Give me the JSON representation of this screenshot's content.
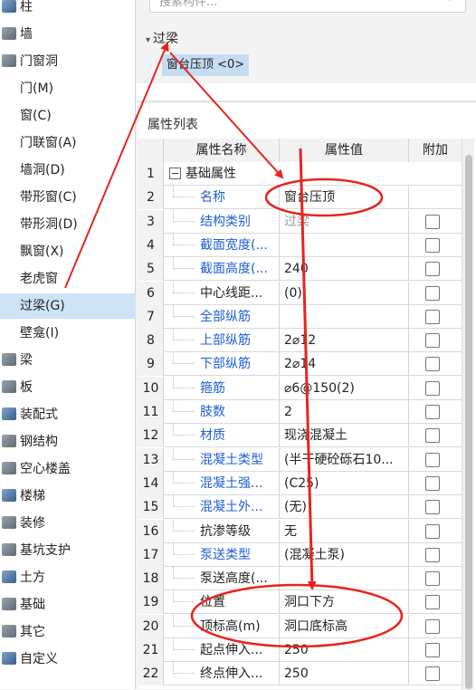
{
  "tree": [
    {
      "label": "柱",
      "kind": "cat",
      "icon": "column-icon"
    },
    {
      "label": "墙",
      "kind": "cat",
      "icon": "wall-icon"
    },
    {
      "label": "门窗洞",
      "kind": "cat",
      "icon": "door-window-icon"
    },
    {
      "label": "门(M)",
      "kind": "sub"
    },
    {
      "label": "窗(C)",
      "kind": "sub"
    },
    {
      "label": "门联窗(A)",
      "kind": "sub"
    },
    {
      "label": "墙洞(D)",
      "kind": "sub"
    },
    {
      "label": "带形窗(C)",
      "kind": "sub"
    },
    {
      "label": "带形洞(D)",
      "kind": "sub"
    },
    {
      "label": "飘窗(X)",
      "kind": "sub"
    },
    {
      "label": "老虎窗",
      "kind": "sub"
    },
    {
      "label": "过梁(G)",
      "kind": "sub",
      "selected": true
    },
    {
      "label": "壁龛(I)",
      "kind": "sub"
    },
    {
      "label": "梁",
      "kind": "cat",
      "icon": "beam-icon"
    },
    {
      "label": "板",
      "kind": "cat",
      "icon": "slab-icon"
    },
    {
      "label": "装配式",
      "kind": "cat",
      "icon": "prefab-icon"
    },
    {
      "label": "钢结构",
      "kind": "cat",
      "icon": "steel-icon"
    },
    {
      "label": "空心楼盖",
      "kind": "cat",
      "icon": "hollow-floor-icon"
    },
    {
      "label": "楼梯",
      "kind": "cat",
      "icon": "stair-icon"
    },
    {
      "label": "装修",
      "kind": "cat",
      "icon": "decoration-icon"
    },
    {
      "label": "基坑支护",
      "kind": "cat",
      "icon": "pit-support-icon"
    },
    {
      "label": "土方",
      "kind": "cat",
      "icon": "earthwork-icon"
    },
    {
      "label": "基础",
      "kind": "cat",
      "icon": "foundation-icon"
    },
    {
      "label": "其它",
      "kind": "cat",
      "icon": "other-icon"
    },
    {
      "label": "自定义",
      "kind": "cat",
      "icon": "custom-icon"
    }
  ],
  "search": {
    "placeholder": "搜索构件..."
  },
  "group": {
    "label": "过梁"
  },
  "component": {
    "label": "窗台压顶 <0>"
  },
  "props": {
    "title": "属性列表",
    "headers": [
      "属性名称",
      "属性值",
      "附加"
    ],
    "rows": [
      {
        "num": "1",
        "name": "基础属性",
        "value": "",
        "group": true
      },
      {
        "num": "2",
        "name": "名称",
        "value": "窗台压顶",
        "blue": true,
        "cb": false
      },
      {
        "num": "3",
        "name": "结构类别",
        "value": "过梁",
        "blue": true,
        "cb": true,
        "muted": true
      },
      {
        "num": "4",
        "name": "截面宽度(...",
        "value": "",
        "blue": true,
        "cb": true
      },
      {
        "num": "5",
        "name": "截面高度(...",
        "value": "240",
        "blue": true,
        "cb": true
      },
      {
        "num": "6",
        "name": "中心线距...",
        "value": "(0)",
        "cb": true
      },
      {
        "num": "7",
        "name": "全部纵筋",
        "value": "",
        "blue": true,
        "cb": true
      },
      {
        "num": "8",
        "name": "上部纵筋",
        "value": "2⌀12",
        "blue": true,
        "cb": true
      },
      {
        "num": "9",
        "name": "下部纵筋",
        "value": "2⌀14",
        "blue": true,
        "cb": true
      },
      {
        "num": "10",
        "name": "箍筋",
        "value": "⌀6@150(2)",
        "blue": true,
        "cb": true
      },
      {
        "num": "11",
        "name": "肢数",
        "value": "2",
        "blue": true,
        "cb": true
      },
      {
        "num": "12",
        "name": "材质",
        "value": "现浇混凝土",
        "blue": true,
        "cb": true
      },
      {
        "num": "13",
        "name": "混凝土类型",
        "value": "(半干硬砼砾石10...",
        "blue": true,
        "cb": true
      },
      {
        "num": "14",
        "name": "混凝土强...",
        "value": "(C25)",
        "blue": true,
        "cb": true
      },
      {
        "num": "15",
        "name": "混凝土外...",
        "value": "(无)",
        "blue": true,
        "cb": true
      },
      {
        "num": "16",
        "name": "抗渗等级",
        "value": "无",
        "cb": true
      },
      {
        "num": "17",
        "name": "泵送类型",
        "value": "(混凝土泵)",
        "blue": true,
        "cb": true
      },
      {
        "num": "18",
        "name": "泵送高度(...",
        "value": "",
        "cb": true
      },
      {
        "num": "19",
        "name": "位置",
        "value": "洞口下方",
        "cb": true
      },
      {
        "num": "20",
        "name": "顶标高(m)",
        "value": "洞口底标高",
        "cb": true
      },
      {
        "num": "21",
        "name": "起点伸入...",
        "value": "250",
        "cb": true
      },
      {
        "num": "22",
        "name": "终点伸入...",
        "value": "250",
        "cb": true
      }
    ]
  },
  "colors": {
    "annotation": "#e8231f",
    "selected": "#cfe3f7",
    "link": "#1e5fd6"
  }
}
